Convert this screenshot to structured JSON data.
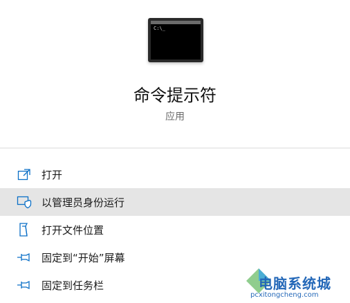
{
  "app": {
    "title": "命令提示符",
    "subtitle": "应用",
    "icon": "command-prompt-icon",
    "prompt_glyph": "C:\\_"
  },
  "menu": {
    "items": [
      {
        "label": "打开",
        "icon": "open-external-icon"
      },
      {
        "label": "以管理员身份运行",
        "icon": "run-as-admin-shield-icon"
      },
      {
        "label": "打开文件位置",
        "icon": "file-location-icon"
      },
      {
        "label": "固定到“开始”屏幕",
        "icon": "pin-icon"
      },
      {
        "label": "固定到任务栏",
        "icon": "pin-icon"
      }
    ],
    "hovered_index": 1
  },
  "watermark": {
    "text": "电脑系统城",
    "url": "pcxitongcheng.com"
  },
  "colors": {
    "accent_icon": "#0a6fc7",
    "hover_bg": "#e5e5e5",
    "watermark": "#2468b8"
  }
}
